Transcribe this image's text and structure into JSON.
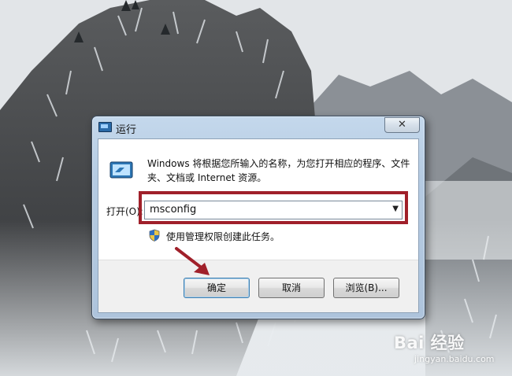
{
  "dialog": {
    "title": "运行",
    "close_label": "✕",
    "description": "Windows 将根据您所输入的名称，为您打开相应的程序、文件夹、文档或 Internet 资源。",
    "open_label": "打开(O):",
    "open_value": "msconfig",
    "admin_note": "使用管理权限创建此任务。",
    "buttons": {
      "ok": "确定",
      "cancel": "取消",
      "browse": "浏览(B)..."
    }
  },
  "annotation": {
    "highlight_color": "#a0202a",
    "arrow_color": "#a0202a"
  },
  "watermark": {
    "brand": "Bai 经验",
    "url": "jingyan.baidu.com"
  }
}
